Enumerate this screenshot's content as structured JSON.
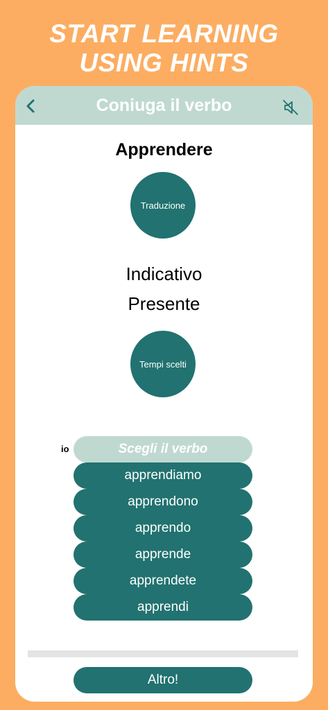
{
  "promo": {
    "line1": "START LEARNING",
    "line2": "USING HINTS"
  },
  "appbar": {
    "title": "Coniuga il verbo",
    "back_icon": "chevron-left-icon",
    "mute_icon": "speaker-muted-icon"
  },
  "verb": "Apprendere",
  "translation_button": "Traduzione",
  "mood": "Indicativo",
  "tense": "Presente",
  "tenses_button": "Tempi scelti",
  "exercise": {
    "pronoun": "io",
    "answer_placeholder": "Scegli il verbo",
    "options": [
      "apprendiamo",
      "apprendono",
      "apprendo",
      "apprende",
      "apprendete",
      "apprendi"
    ]
  },
  "progress": 0,
  "more_button": "Altro!",
  "colors": {
    "background": "#fcad62",
    "accent": "#217270",
    "appbar": "#bfd9d1"
  }
}
